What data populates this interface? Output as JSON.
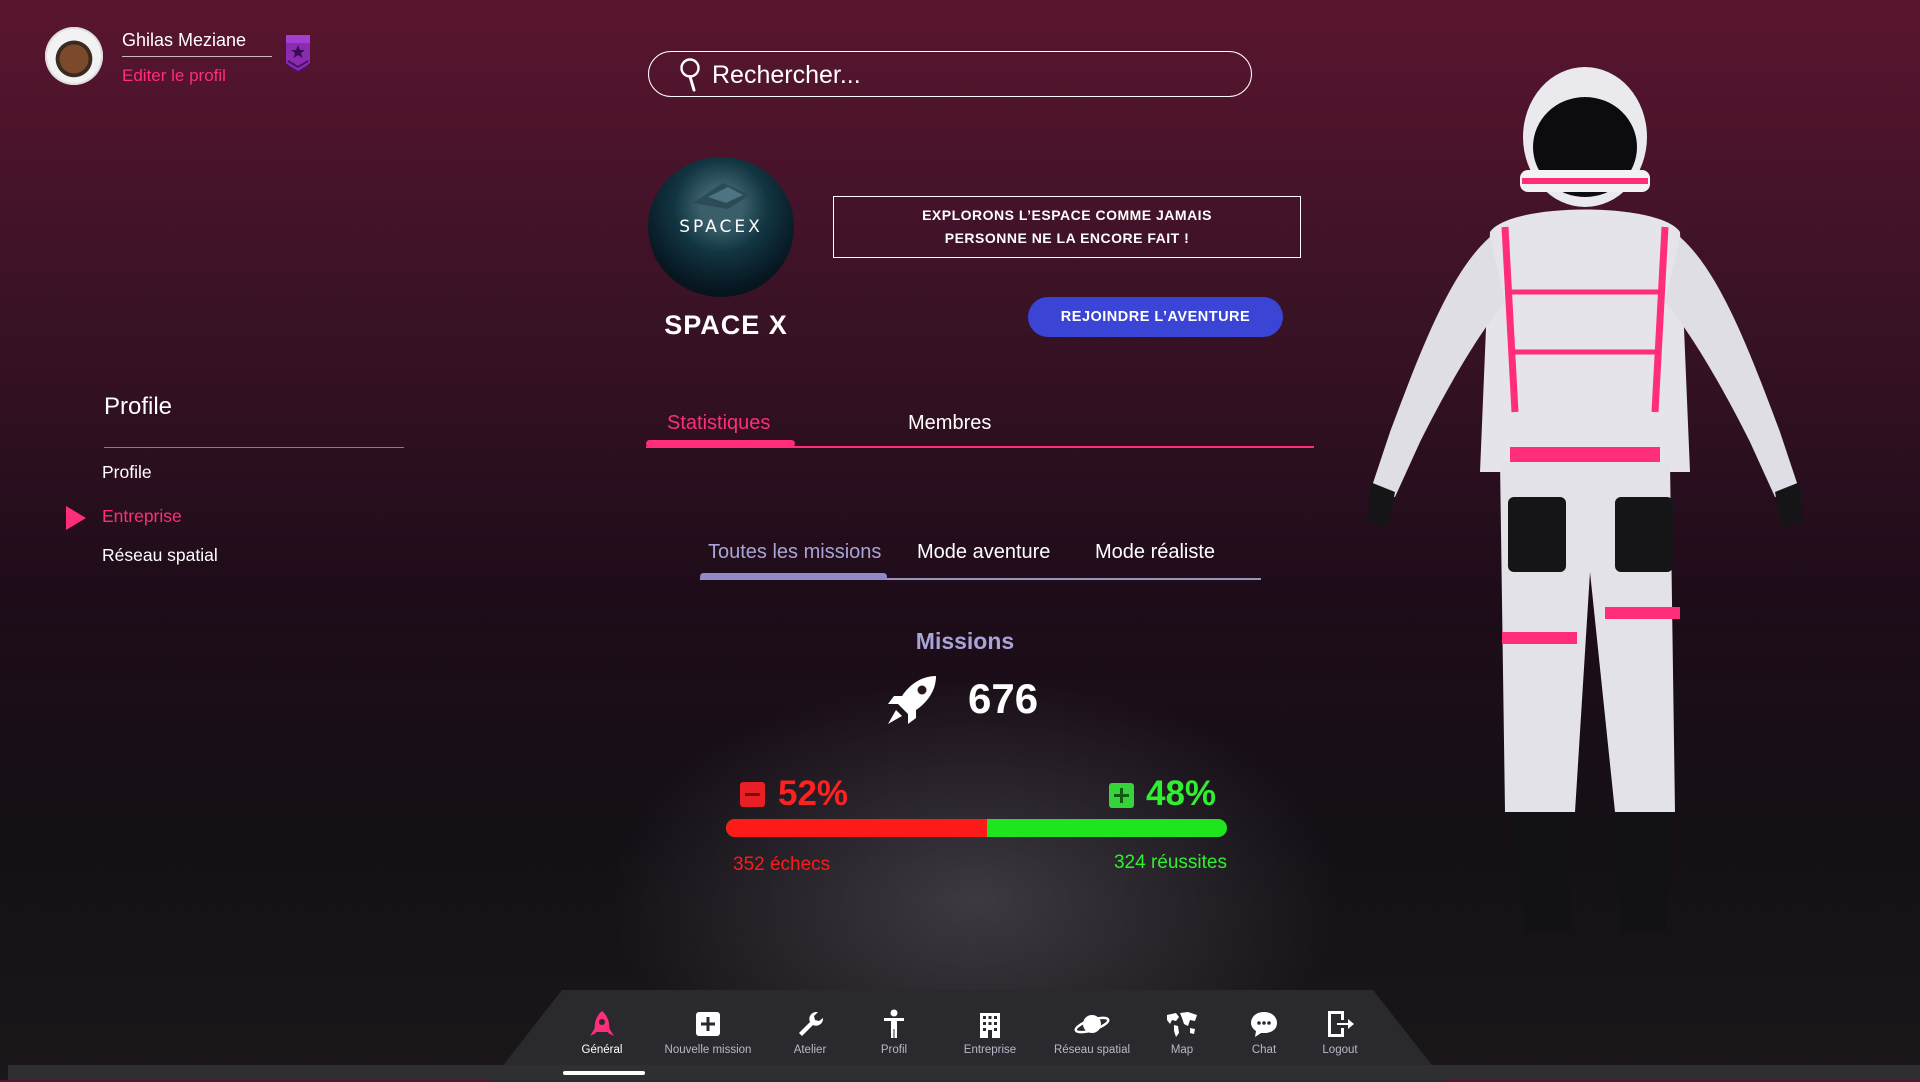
{
  "user": {
    "name": "Ghilas Meziane",
    "edit_label": "Editer le profil"
  },
  "search": {
    "placeholder": "Rechercher..."
  },
  "company": {
    "logo_text": "SPACEX",
    "name": "SPACE X",
    "motto": "EXPLORONS L’ESPACE COMME JAMAIS\nPERSONNE NE LA ENCORE FAIT !",
    "join_label": "REJOINDRE L’AVENTURE"
  },
  "side_menu": {
    "title": "Profile",
    "items": [
      {
        "label": "Profile",
        "active": false
      },
      {
        "label": "Entreprise",
        "active": true
      },
      {
        "label": "Réseau spatial",
        "active": false
      }
    ]
  },
  "main_tabs": [
    {
      "label": "Statistiques",
      "active": true
    },
    {
      "label": "Membres",
      "active": false
    }
  ],
  "sub_tabs": [
    {
      "label": "Toutes les missions",
      "active": true
    },
    {
      "label": "Mode aventure",
      "active": false
    },
    {
      "label": "Mode réaliste",
      "active": false
    }
  ],
  "stats": {
    "title": "Missions",
    "total": "676",
    "fail_pct_label": "52%",
    "success_pct_label": "48%",
    "fail_fraction": 0.52,
    "fail_text": "352 échecs",
    "success_text": "324 réussites"
  },
  "bottom_nav": [
    {
      "label": "Général",
      "icon": "rocket-icon",
      "active": true
    },
    {
      "label": "Nouvelle mission",
      "icon": "plus-square-icon",
      "active": false
    },
    {
      "label": "Atelier",
      "icon": "wrench-icon",
      "active": false
    },
    {
      "label": "Profil",
      "icon": "person-icon",
      "active": false
    },
    {
      "label": "Entreprise",
      "icon": "building-icon",
      "active": false
    },
    {
      "label": "Réseau spatial",
      "icon": "planet-icon",
      "active": false
    },
    {
      "label": "Map",
      "icon": "world-map-icon",
      "active": false
    },
    {
      "label": "Chat",
      "icon": "chat-bubble-icon",
      "active": false
    },
    {
      "label": "Logout",
      "icon": "logout-icon",
      "active": false
    }
  ],
  "colors": {
    "accent": "#ff2d7a",
    "button": "#3a45d6",
    "fail": "#ff1a1a",
    "success": "#2ff02f",
    "subtab": "#a9a3d8"
  }
}
